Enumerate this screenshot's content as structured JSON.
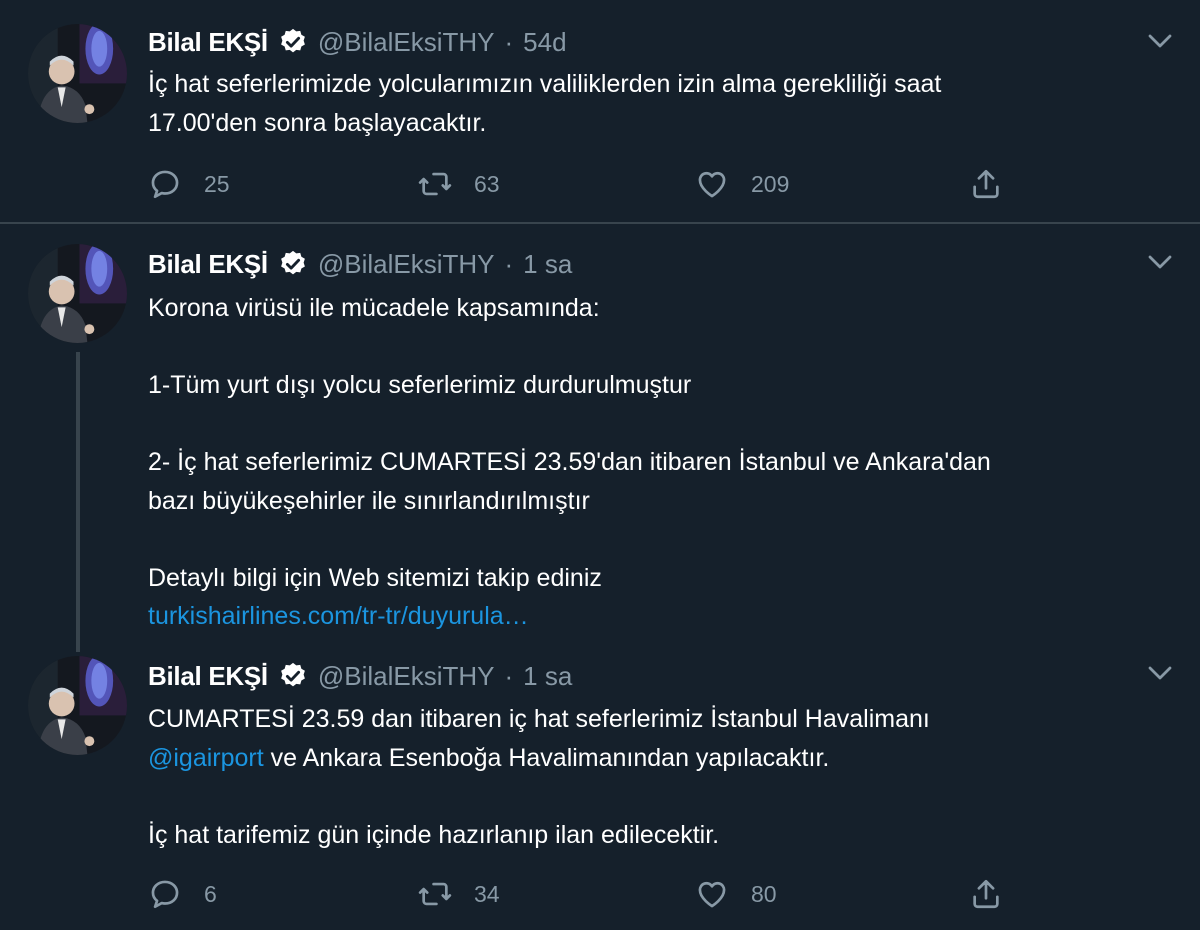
{
  "tweets": [
    {
      "name": "Bilal EKŞİ",
      "handle": "@BilalEksiTHY",
      "separator": "·",
      "time": "54d",
      "lines": [
        "İç hat seferlerimizde yolcularımızın  valiliklerden izin alma gerekliliği saat",
        "17.00'den sonra başlayacaktır."
      ],
      "actions": {
        "replies": "25",
        "retweets": "63",
        "likes": "209"
      }
    },
    {
      "name": "Bilal EKŞİ",
      "handle": "@BilalEksiTHY",
      "separator": "·",
      "time": "1 sa",
      "lines": [
        "Korona virüsü ile mücadele kapsamında:",
        "1-Tüm yurt dışı yolcu seferlerimiz durdurulmuştur",
        "2- İç hat seferlerimiz CUMARTESİ 23.59'dan itibaren  İstanbul ve Ankara'dan",
        "bazı büyükeşehirler ile sınırlandırılmıştır",
        "Detaylı bilgi için Web sitemizi takip ediniz"
      ],
      "link": "turkishairlines.com/tr-tr/duyurula…"
    },
    {
      "name": "Bilal EKŞİ",
      "handle": "@BilalEksiTHY",
      "separator": "·",
      "time": "1 sa",
      "lines": [
        "CUMARTESİ 23.59 dan itibaren iç hat seferlerimiz İstanbul Havalimanı",
        "ve Ankara Esenboğa  Havalimanından yapılacaktır.",
        "İç hat tarifemiz gün içinde hazırlanıp ilan edilecektir."
      ],
      "mention": "@igairport",
      "actions": {
        "replies": "6",
        "retweets": "34",
        "likes": "80"
      }
    }
  ],
  "icons": {
    "verified": "verified-badge-icon",
    "chevron": "chevron-down-icon",
    "reply": "reply-icon",
    "retweet": "retweet-icon",
    "like": "heart-icon",
    "share": "share-icon"
  },
  "colors": {
    "background": "#15202b",
    "text": "#ffffff",
    "muted": "#8899a6",
    "link": "#1b95e0",
    "divider": "#38444d"
  }
}
